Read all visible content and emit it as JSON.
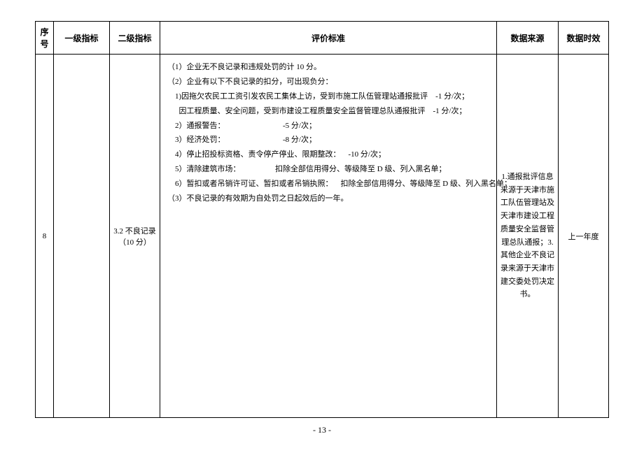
{
  "headers": {
    "seq": "序号",
    "level1": "一级指标",
    "level2": "二级指标",
    "criteria": "评价标准",
    "source": "数据来源",
    "validity": "数据时效"
  },
  "row": {
    "seq": "8",
    "level1": "",
    "level2": "3.2 不良记录（10 分）",
    "criteria": {
      "l1": "（1）企业无不良记录和违规处罚的计 10 分。",
      "l2": "（2）企业有以下不良记录的扣分，可出现负分：",
      "l3": "    1)因拖欠农民工工资引发农民工集体上访，受到市施工队伍管理站通报批评    -1 分/次；",
      "l4": "      因工程质量、安全问题，受到市建设工程质量安全监督管理总队通报批评    -1 分/次；",
      "l5": "    2）通报警告：                              -5 分/次；",
      "l6": "    3）经济处罚：                              -8 分/次；",
      "l7": "    4）停止招投标资格、责令停产停业、限期整改：    -10 分/次；",
      "l8": "    5）清除建筑市场：                  扣除全部信用得分、等级降至 D 级、列入黑名单；",
      "l9": "    6）暂扣或者吊销许可证、暂扣或者吊销执照：    扣除全部信用得分、等级降至 D 级、列入黑名单；",
      "l10": "（3）不良记录的有效期为自处罚之日起效后的一年。"
    },
    "source": "1.通报批评信息来源于天津市施工队伍管理站及天津市建设工程质量安全监督管理总队通报；3.其他企业不良记录来源于天津市建交委处罚决定书。",
    "validity": "上一年度"
  },
  "page_number": "- 13 -"
}
